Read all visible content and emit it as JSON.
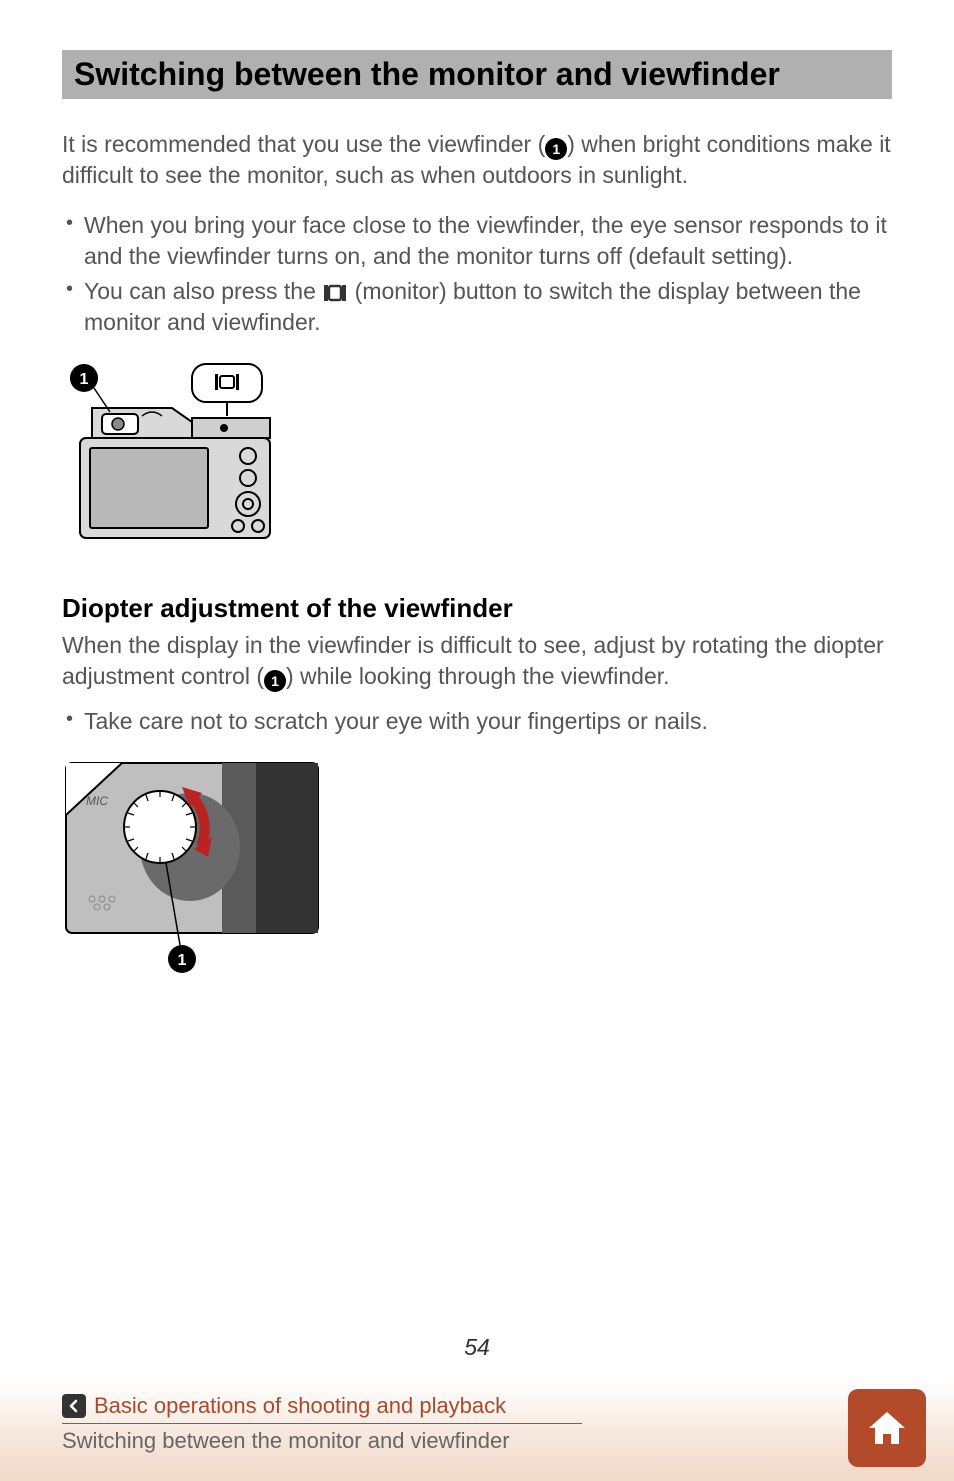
{
  "title": "Switching between the monitor and viewfinder",
  "intro_before": "It is recommended that you use the viewfinder (",
  "intro_after": ") when bright conditions make it difficult to see the monitor, such as when outdoors in sunlight.",
  "bullets": {
    "b1": "When you bring your face close to the viewfinder, the eye sensor responds to it and the viewfinder turns on, and the monitor turns off (default setting).",
    "b2_before": "You can also press the ",
    "b2_after": " (monitor) button to switch the display between the monitor and viewfinder."
  },
  "subheading": "Diopter adjustment of the viewfinder",
  "sub_body_before": "When the display in the viewfinder is difficult to see, adjust by rotating the diopter adjustment control (",
  "sub_body_after": ") while looking through the viewfinder.",
  "sub_bullet": "Take care not to scratch your eye with your fingertips or nails.",
  "page_number": "54",
  "footer": {
    "chapter": "Basic operations of shooting and playback",
    "section": "Switching between the monitor and viewfinder"
  },
  "marker_1": "1"
}
